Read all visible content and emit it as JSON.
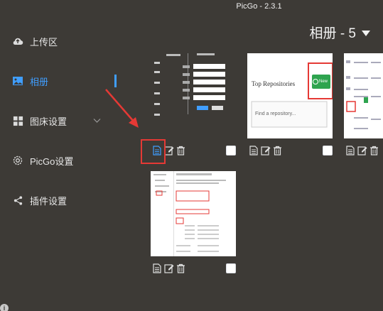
{
  "window": {
    "title": "PicGo - 2.3.1"
  },
  "sidebar": {
    "items": [
      {
        "label": "上传区",
        "icon": "cloud-upload-icon"
      },
      {
        "label": "相册",
        "icon": "image-icon",
        "active": true
      },
      {
        "label": "图床设置",
        "icon": "grid-icon",
        "expandable": true
      },
      {
        "label": "PicGo设置",
        "icon": "gear-icon"
      },
      {
        "label": "插件设置",
        "icon": "share-icon"
      }
    ]
  },
  "gallery": {
    "title": "相册 - 5",
    "images": [
      {
        "kind": "settings-form-screenshot",
        "selected": false
      },
      {
        "label_top": "Top Repositories",
        "button": "New",
        "search_placeholder": "Find a repository...",
        "selected": false
      },
      {
        "kind": "table-screenshot",
        "selected": false
      },
      {
        "kind": "settings-page-screenshot",
        "selected": false
      }
    ]
  },
  "colors": {
    "background": "#3d3a36",
    "accent": "#409eff",
    "annotation": "#e53935",
    "new_button": "#2ea44f"
  }
}
